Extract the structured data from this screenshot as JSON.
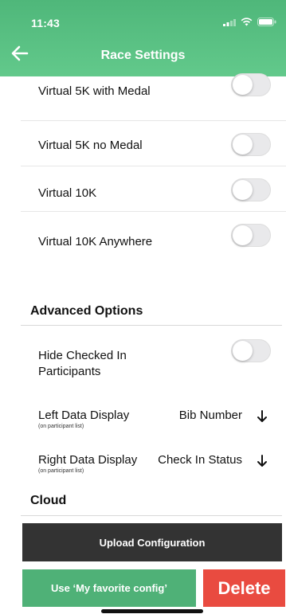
{
  "status_bar": {
    "time": "11:43"
  },
  "header": {
    "title": "Race Settings"
  },
  "races": [
    {
      "label": "Virtual 5K with Medal",
      "enabled": false
    },
    {
      "label": "Virtual 5K no Medal",
      "enabled": false
    },
    {
      "label": "Virtual 10K",
      "enabled": false
    },
    {
      "label": "Virtual 10K Anywhere",
      "enabled": false
    }
  ],
  "advanced": {
    "title": "Advanced Options",
    "hide_checked_in": {
      "label": "Hide Checked In Participants",
      "enabled": false
    },
    "left_display": {
      "label": "Left Data Display",
      "sub": "(on participant list)",
      "value": "Bib Number"
    },
    "right_display": {
      "label": "Right Data Display",
      "sub": "(on participant list)",
      "value": "Check In Status"
    }
  },
  "cloud": {
    "title": "Cloud",
    "upload_label": "Upload Configuration",
    "favorite_label": "Use ‘My favorite config’",
    "delete_label": "Delete"
  },
  "colors": {
    "header_green": "#5cc285",
    "upload_dark": "#333333",
    "favorite_green": "#4fb177",
    "delete_red": "#e94b40"
  }
}
